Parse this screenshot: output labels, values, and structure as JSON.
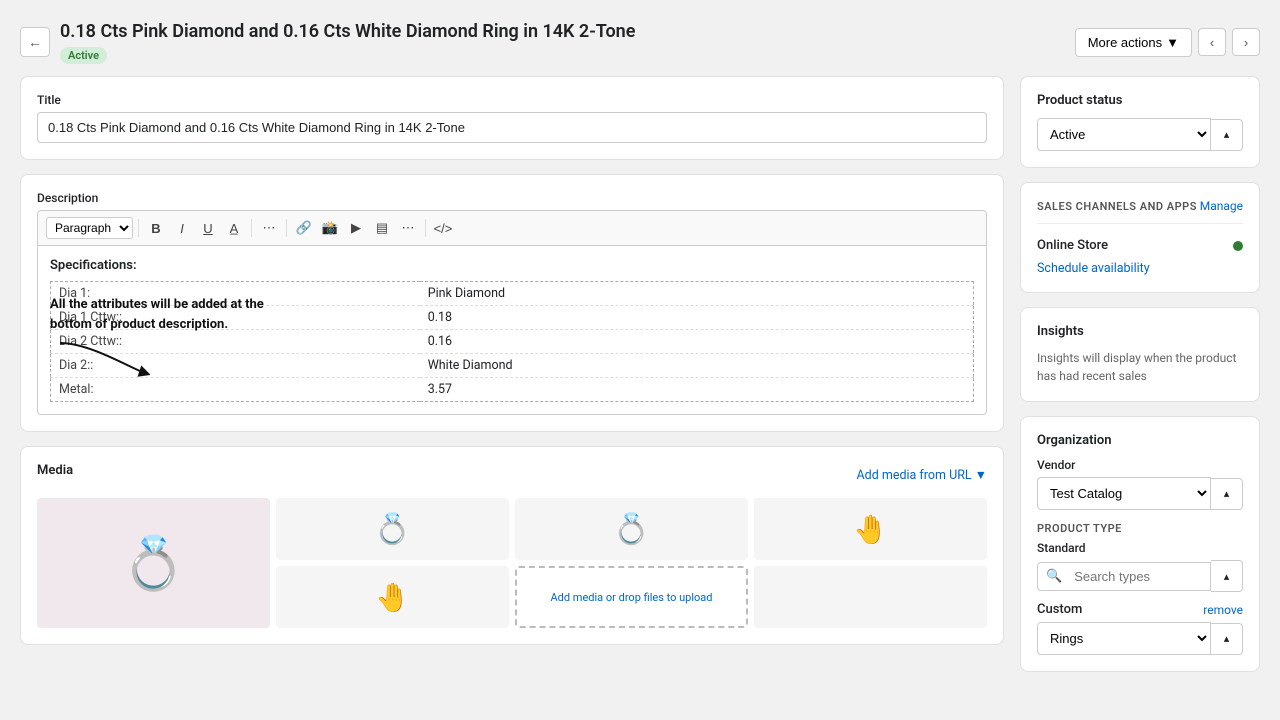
{
  "header": {
    "title": "0.18 Cts Pink Diamond and 0.16 Cts White Diamond Ring in 14K 2-Tone",
    "status": "Active",
    "more_actions_label": "More actions"
  },
  "title_section": {
    "label": "Title",
    "value": "0.18 Cts Pink Diamond and 0.16 Cts White Diamond Ring in 14K 2-Tone"
  },
  "description_section": {
    "label": "Description",
    "toolbar": {
      "paragraph_label": "Paragraph",
      "bold": "B",
      "italic": "I",
      "underline": "U"
    },
    "specs_title": "Specifications:",
    "specs": [
      {
        "key": "Dia 1:",
        "value": "Pink Diamond"
      },
      {
        "key": "Dia 1 Cttw::",
        "value": "0.18"
      },
      {
        "key": "Dia 2 Cttw::",
        "value": "0.16"
      },
      {
        "key": "Dia 2::",
        "value": "White Diamond"
      },
      {
        "key": "Metal:",
        "value": "3.57"
      }
    ]
  },
  "media_section": {
    "label": "Media",
    "add_media_label": "Add media from URL",
    "add_media_placeholder": "Add media\nor drop files to\nupload"
  },
  "product_status": {
    "title": "Product status",
    "status_value": "Active"
  },
  "sales_channels": {
    "title": "SALES CHANNELS AND APPS",
    "manage_label": "Manage",
    "online_store_label": "Online Store",
    "schedule_label": "Schedule availability"
  },
  "insights": {
    "title": "Insights",
    "body": "Insights will display when the product has had recent sales"
  },
  "organization": {
    "title": "Organization",
    "vendor_label": "Vendor",
    "vendor_value": "Test Catalog",
    "product_type_label": "PRODUCT TYPE",
    "standard_label": "Standard",
    "search_placeholder": "Search types",
    "custom_label": "Custom",
    "remove_label": "remove",
    "rings_value": "Rings"
  },
  "annotation": {
    "text": "All the attributes will be added at the bottom of product description."
  }
}
